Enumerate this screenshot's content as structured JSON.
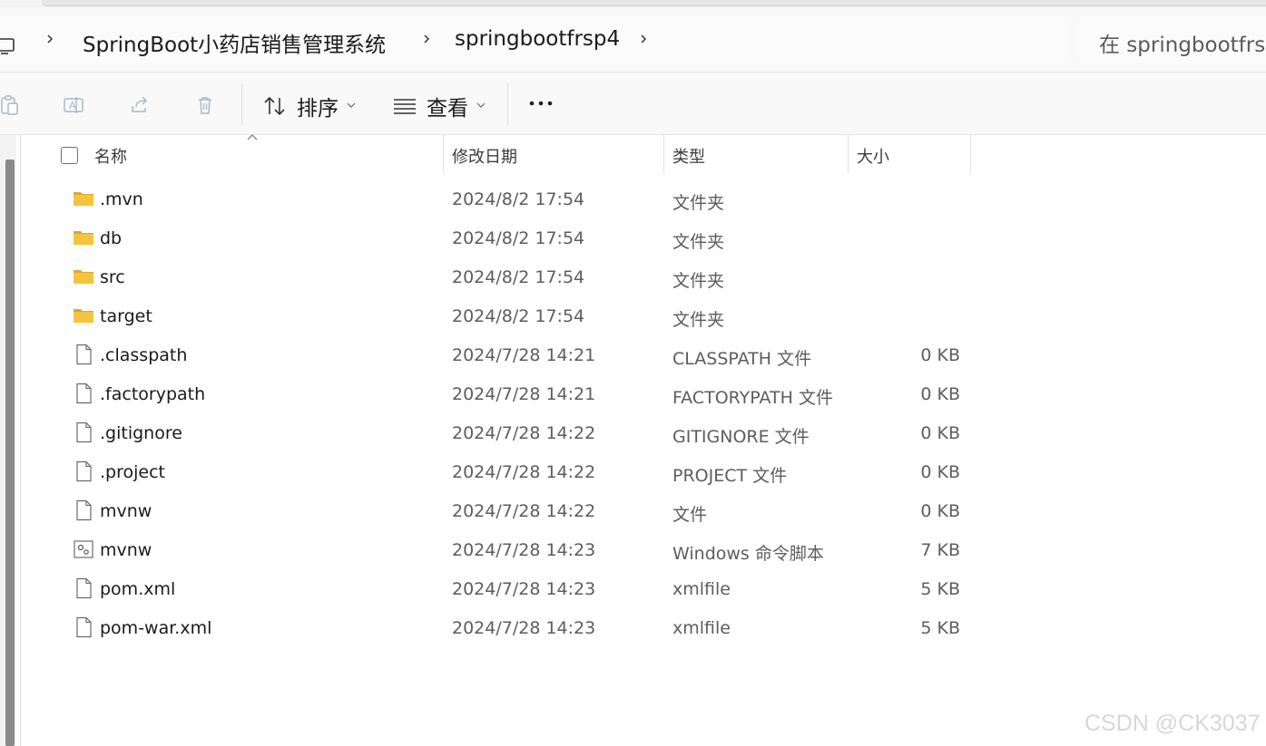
{
  "breadcrumb": {
    "items": [
      "SpringBoot小药店销售管理系统",
      "springbootfrsp4"
    ]
  },
  "search": {
    "placeholder": "在 springbootfrsp"
  },
  "toolbar": {
    "sort_label": "排序",
    "view_label": "查看",
    "more_label": "···",
    "icons": [
      "paste-icon",
      "rename-icon",
      "share-icon",
      "delete-icon"
    ]
  },
  "columns": {
    "name": "名称",
    "modified": "修改日期",
    "type": "类型",
    "size": "大小"
  },
  "files": [
    {
      "icon": "folder-icon",
      "name": ".mvn",
      "date": "2024/8/2 17:54",
      "type": "文件夹",
      "size": ""
    },
    {
      "icon": "folder-icon",
      "name": "db",
      "date": "2024/8/2 17:54",
      "type": "文件夹",
      "size": ""
    },
    {
      "icon": "folder-icon",
      "name": "src",
      "date": "2024/8/2 17:54",
      "type": "文件夹",
      "size": ""
    },
    {
      "icon": "folder-icon",
      "name": "target",
      "date": "2024/8/2 17:54",
      "type": "文件夹",
      "size": ""
    },
    {
      "icon": "file-icon",
      "name": ".classpath",
      "date": "2024/7/28 14:21",
      "type": "CLASSPATH 文件",
      "size": "0 KB"
    },
    {
      "icon": "file-icon",
      "name": ".factorypath",
      "date": "2024/7/28 14:21",
      "type": "FACTORYPATH 文件",
      "size": "0 KB"
    },
    {
      "icon": "file-icon",
      "name": ".gitignore",
      "date": "2024/7/28 14:22",
      "type": "GITIGNORE 文件",
      "size": "0 KB"
    },
    {
      "icon": "file-icon",
      "name": ".project",
      "date": "2024/7/28 14:22",
      "type": "PROJECT 文件",
      "size": "0 KB"
    },
    {
      "icon": "file-icon",
      "name": "mvnw",
      "date": "2024/7/28 14:22",
      "type": "文件",
      "size": "0 KB"
    },
    {
      "icon": "script-file-icon",
      "name": "mvnw",
      "date": "2024/7/28 14:23",
      "type": "Windows 命令脚本",
      "size": "7 KB"
    },
    {
      "icon": "file-icon",
      "name": "pom.xml",
      "date": "2024/7/28 14:23",
      "type": "xmlfile",
      "size": "5 KB"
    },
    {
      "icon": "file-icon",
      "name": "pom-war.xml",
      "date": "2024/7/28 14:23",
      "type": "xmlfile",
      "size": "5 KB"
    }
  ],
  "watermark": "CSDN @CK3037",
  "colors": {
    "folder": "#f4c441",
    "folder_dark": "#e0a82a",
    "text": "#1a1a1a",
    "muted": "#5d5d5d"
  }
}
